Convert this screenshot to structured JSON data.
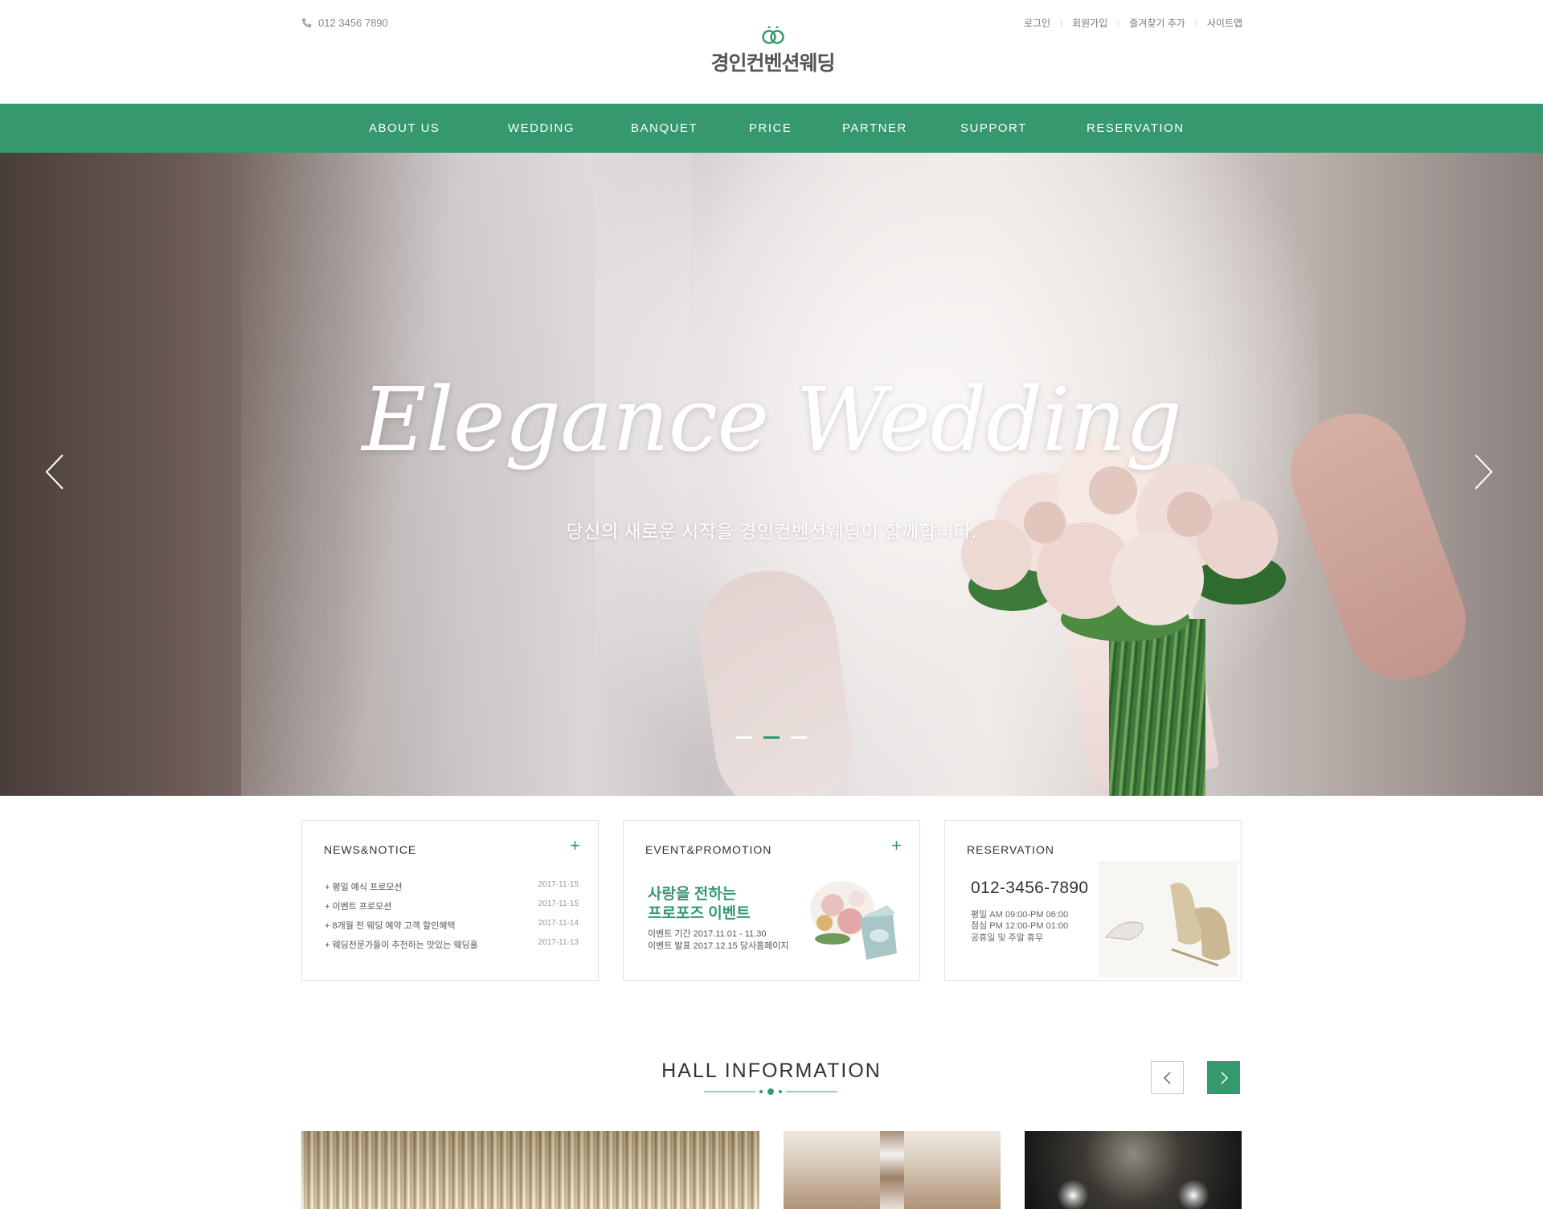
{
  "header": {
    "phone": "012 3456 7890",
    "logo_text": "경인컨벤션웨딩",
    "util_links": [
      "로그인",
      "회원가입",
      "즐겨찾기 추가",
      "사이트맵"
    ]
  },
  "nav": {
    "items": [
      "ABOUT US",
      "WEDDING",
      "BANQUET",
      "PRICE",
      "PARTNER",
      "SUPPORT",
      "RESERVATION"
    ]
  },
  "hero": {
    "title": "Elegance Wedding",
    "subtitle": "당신의 새로운 시작을 경인컨벤션웨딩이 함께합니다.",
    "slides_total": 3,
    "active_slide": 2
  },
  "news": {
    "title": "NEWS&NOTICE",
    "items": [
      {
        "text": "+ 평일 예식 프로모션",
        "date": "2017-11-15"
      },
      {
        "text": "+ 이벤트 프로모션",
        "date": "2017-11-15"
      },
      {
        "text": "+ 8개월 전 웨딩 예약 고객 할인혜택",
        "date": "2017-11-14"
      },
      {
        "text": "+ 웨딩전문가들이 추천하는 맛있는 웨딩홀",
        "date": "2017-11-13"
      }
    ]
  },
  "promotion": {
    "title": "EVENT&PROMOTION",
    "headline_1": "사랑을 전하는",
    "headline_2": "프로포즈 이벤트",
    "period": "이벤트 기간 2017.11.01 - 11.30",
    "announce": "이벤트 발표 2017.12.15 당사홈페이지"
  },
  "reservation": {
    "title": "RESERVATION",
    "phone": "012-3456-7890",
    "hours_1": "평일 AM 09:00-PM 06:00",
    "hours_2": "점심 PM 12:00-PM 01:00",
    "hours_3": "공휴일 및 주말 휴무"
  },
  "hall": {
    "title": "HALL INFORMATION"
  },
  "colors": {
    "accent": "#35986f",
    "text": "#333333",
    "muted": "#999999"
  }
}
